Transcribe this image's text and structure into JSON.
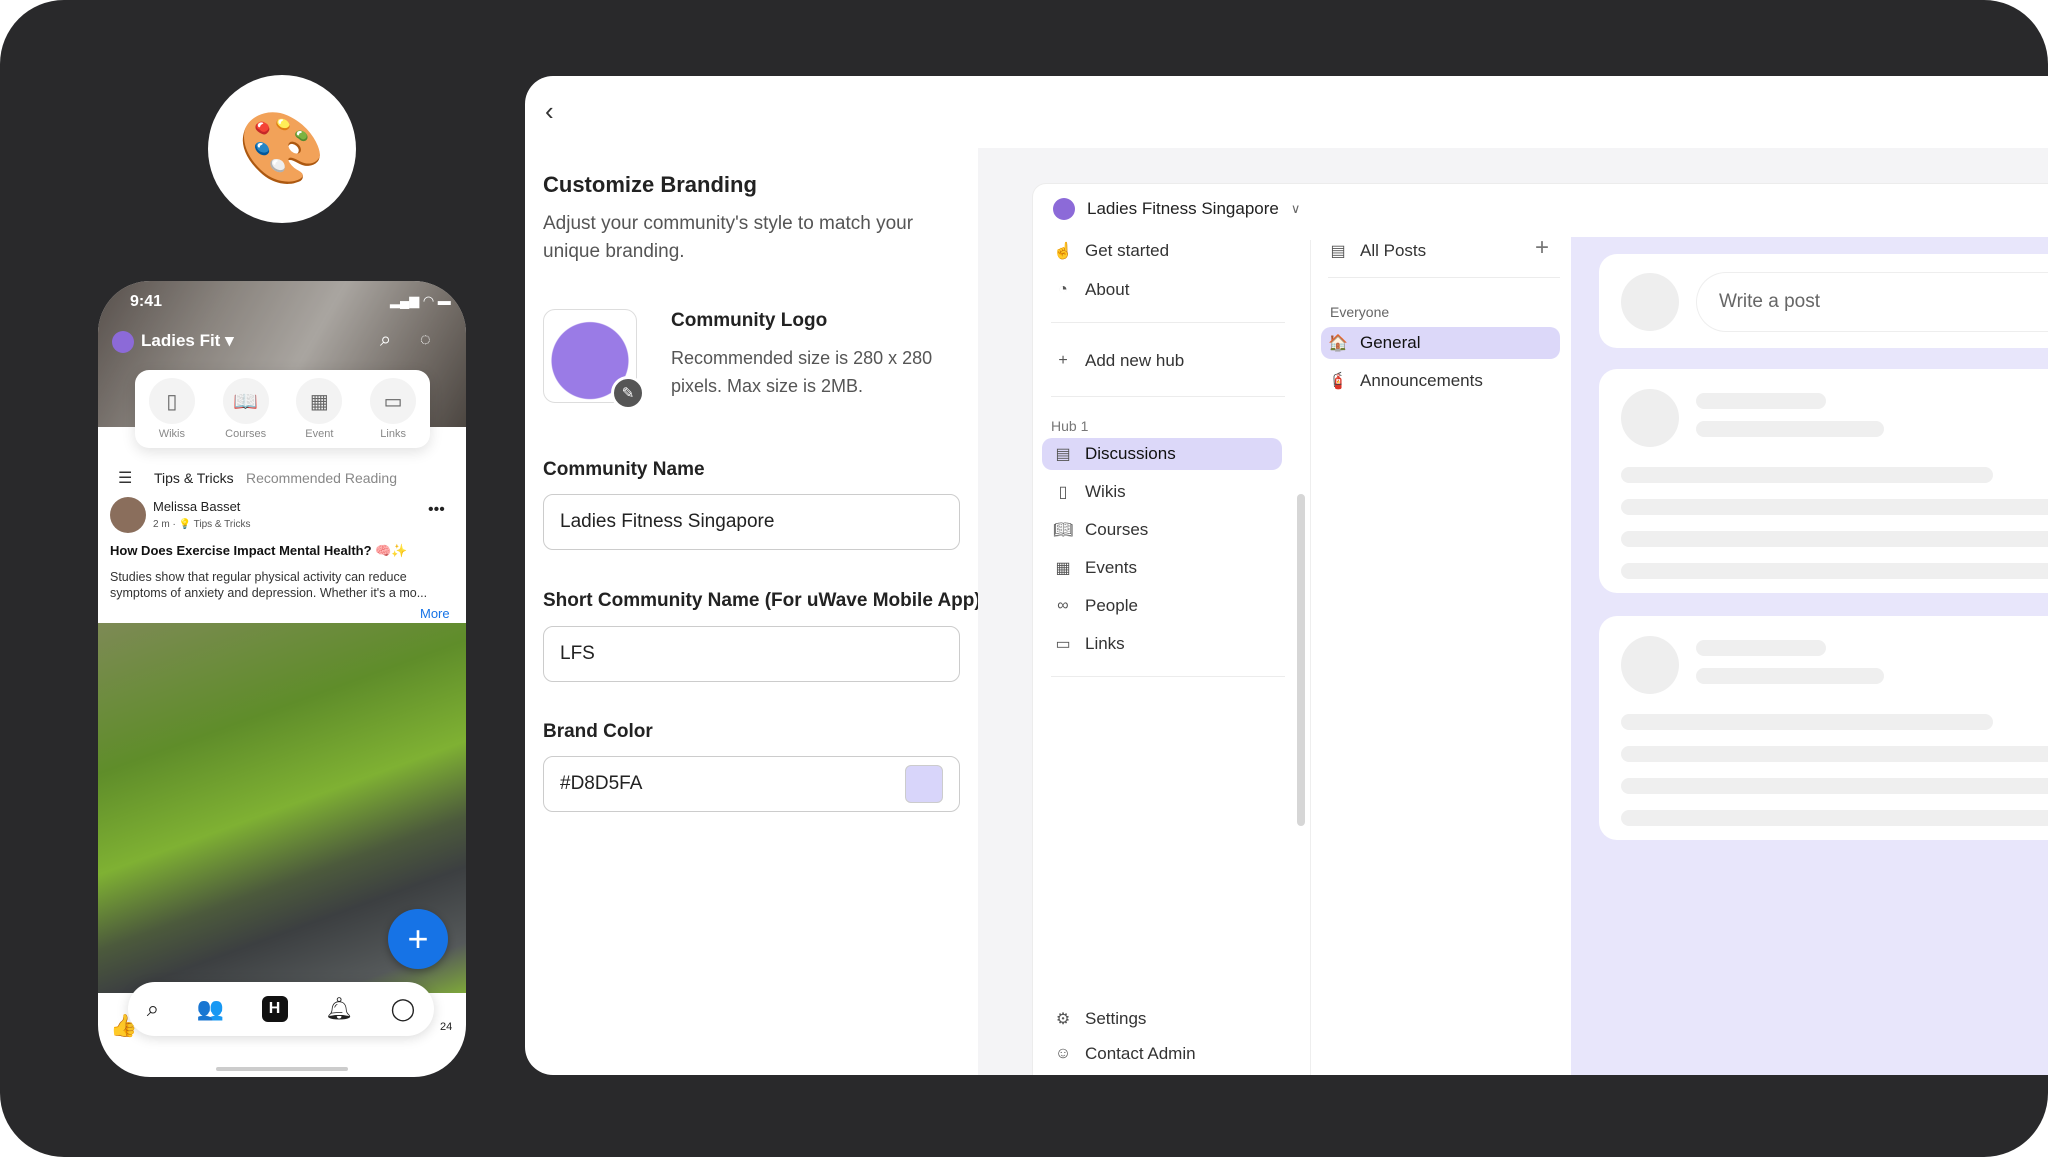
{
  "palette_icon": "artist-palette-icon",
  "phone": {
    "time": "9:41",
    "community": "Ladies Fit",
    "shortcuts": [
      {
        "label": "Wikis",
        "icon": "bookmark-book-icon"
      },
      {
        "label": "Courses",
        "icon": "open-book-icon"
      },
      {
        "label": "Event",
        "icon": "calendar-icon"
      },
      {
        "label": "Links",
        "icon": "folder-icon"
      }
    ],
    "tabs": [
      "Tips & Tricks",
      "Recommended Reading"
    ],
    "post": {
      "author": "Melissa Basset",
      "meta_time": "2 m",
      "meta_channel": "Tips & Tricks",
      "title": "How Does Exercise Impact Mental Health? 🧠✨",
      "body": "Studies show that regular physical activity can reduce symptoms of anxiety and depression. Whether it's a mo...",
      "more": "More",
      "count": "24"
    },
    "bottom_nav": [
      "search-icon",
      "people-icon",
      "home-icon",
      "bell-icon",
      "profile-icon"
    ]
  },
  "branding": {
    "title": "Customize Branding",
    "subtitle": "Adjust your community's style to match your unique branding.",
    "logo_label": "Community Logo",
    "logo_hint": "Recommended size is 280 x 280 pixels. Max size is 2MB.",
    "name_label": "Community Name",
    "name_value": "Ladies Fitness Singapore",
    "short_label": "Short Community Name (For uWave Mobile App)",
    "short_value": "LFS",
    "color_label": "Brand Color",
    "color_value": "#D8D5FA"
  },
  "preview": {
    "community": "Ladies Fitness Singapore",
    "nav_top": [
      {
        "label": "Get started",
        "icon": "pointer-click-icon"
      },
      {
        "label": "About",
        "icon": "about-icon"
      }
    ],
    "add_hub": "Add new hub",
    "hub_label": "Hub 1",
    "hub_items": [
      {
        "label": "Discussions",
        "icon": "document-icon"
      },
      {
        "label": "Wikis",
        "icon": "bookmark-icon"
      },
      {
        "label": "Courses",
        "icon": "book-icon"
      },
      {
        "label": "Events",
        "icon": "calendar-icon"
      },
      {
        "label": "People",
        "icon": "people-icon"
      },
      {
        "label": "Links",
        "icon": "folder-icon"
      }
    ],
    "nav_bottom": [
      {
        "label": "Settings",
        "icon": "gear-icon"
      },
      {
        "label": "Contact Admin",
        "icon": "contact-icon"
      }
    ],
    "all_posts": "All Posts",
    "group_label": "Everyone",
    "channels": [
      {
        "label": "General",
        "icon": "🏠"
      },
      {
        "label": "Announcements",
        "icon": "🧯"
      }
    ],
    "write_placeholder": "Write a post"
  },
  "colors": {
    "accent": "#D8D5FA",
    "fab": "#1673E6",
    "selected": "#DCD8F9"
  }
}
